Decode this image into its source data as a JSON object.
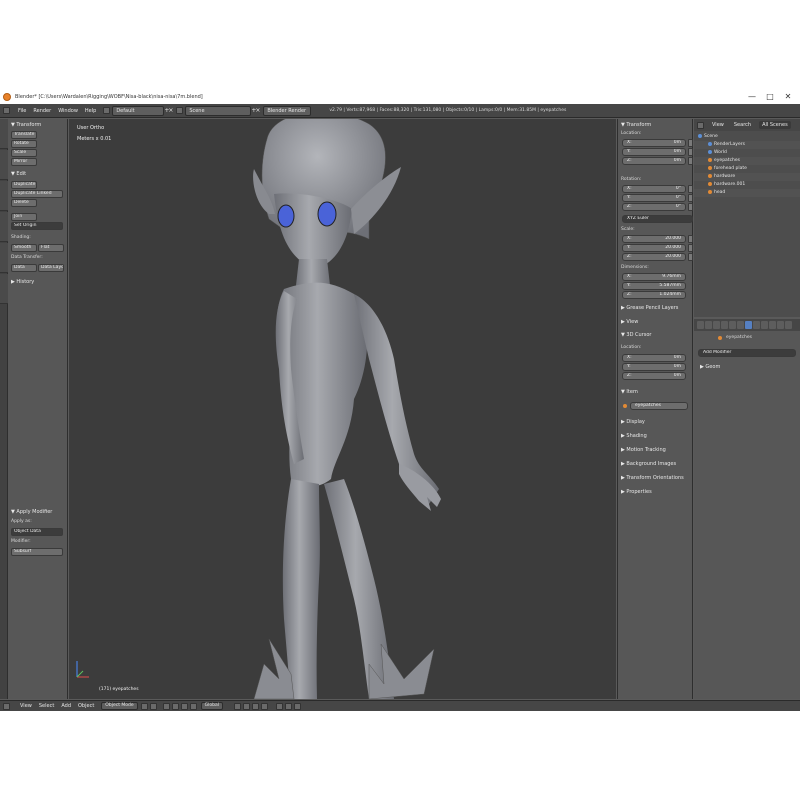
{
  "window": {
    "title": "Blender* [C:\\Users\\Wardalen\\Rigging\\WOBF\\Nisa-black\\nisa-nisa\\7m.blend]",
    "minimize": "—",
    "maximize": "□",
    "close": "✕"
  },
  "header": {
    "menus": [
      "File",
      "Render",
      "Window",
      "Help"
    ],
    "layout": "Default",
    "scene": "Scene",
    "engine": "Blender Render",
    "stats": "v2.79 | Verts:87,968 | Faces:88,320 | Tris:131,080 | Objects:0/10 | Lamps:0/0 | Mem:31.85M | eyepatches"
  },
  "toolshelf": {
    "transform_title": "▼ Transform",
    "transform_buttons": [
      "Translate",
      "Rotate",
      "Scale",
      "Mirror"
    ],
    "edit_title": "▼ Edit",
    "edit_buttons": [
      "Duplicate",
      "Duplicate Linked",
      "Delete"
    ],
    "join_label": "Join",
    "set_origin": "Set Origin",
    "shading_label": "Shading:",
    "smooth_label": "Smooth",
    "flat_label": "Flat",
    "data_transfer_label": "Data Transfer:",
    "data_label": "Data",
    "data_layout_label": "Data Layo",
    "history_title": "▶ History",
    "apply_modifier_title": "▼ Apply Modifier",
    "apply_as_label": "Apply as:",
    "apply_as_value": "Object Data",
    "modifier_label": "Modifier:",
    "modifier_value": "Subsurf"
  },
  "viewport": {
    "view_name": "User Ortho",
    "meters": "Meters x 0.01",
    "object_label": "(171) eyepatches"
  },
  "npanel": {
    "transform_title": "▼ Transform",
    "location_label": "Location:",
    "location": [
      {
        "k": "X:",
        "v": "0m"
      },
      {
        "k": "Y:",
        "v": "0m"
      },
      {
        "k": "Z:",
        "v": "0m"
      }
    ],
    "rotation_label": "Rotation:",
    "rotation": [
      {
        "k": "X:",
        "v": "0°"
      },
      {
        "k": "Y:",
        "v": "0°"
      },
      {
        "k": "Z:",
        "v": "0°"
      }
    ],
    "rotation_mode": "XYZ Euler",
    "scale_label": "Scale:",
    "scale": [
      {
        "k": "X:",
        "v": "20.000"
      },
      {
        "k": "Y:",
        "v": "20.000"
      },
      {
        "k": "Z:",
        "v": "20.000"
      }
    ],
    "dimensions_label": "Dimensions:",
    "dimensions": [
      {
        "k": "X:",
        "v": "9.76mm"
      },
      {
        "k": "Y:",
        "v": "5.587mm"
      },
      {
        "k": "Z:",
        "v": "1.024mm"
      }
    ],
    "grease_pencil": "▶ Grease Pencil Layers",
    "view": "▶ View",
    "cursor_title": "▼ 3D Cursor",
    "cursor_location_label": "Location:",
    "cursor": [
      {
        "k": "X:",
        "v": "0m"
      },
      {
        "k": "Y:",
        "v": "0m"
      },
      {
        "k": "Z:",
        "v": "0m"
      }
    ],
    "item_title": "▼ Item",
    "item_name": "eyepatches",
    "collapsed": [
      "▶ Display",
      "▶ Shading",
      "▶ Motion Tracking",
      "▶ Background Images",
      "▶ Transform Orientations",
      "▶ Properties"
    ]
  },
  "outliner": {
    "view": "View",
    "search": "Search",
    "filter": "All Scenes",
    "rows": [
      {
        "name": "Scene",
        "indent": 0,
        "icon": "scene"
      },
      {
        "name": "RenderLayers",
        "indent": 1,
        "icon": "layers"
      },
      {
        "name": "World",
        "indent": 1,
        "icon": "world"
      },
      {
        "name": "eyepatches",
        "indent": 1,
        "icon": "mesh"
      },
      {
        "name": "forehead plate",
        "indent": 1,
        "icon": "mesh"
      },
      {
        "name": "hardware",
        "indent": 1,
        "icon": "mesh"
      },
      {
        "name": "hardware.001",
        "indent": 1,
        "icon": "mesh"
      },
      {
        "name": "head",
        "indent": 1,
        "icon": "mesh"
      }
    ]
  },
  "properties": {
    "object_name": "eyepatches",
    "add_modifier": "Add Modifier",
    "geom": "▶ Geom"
  },
  "footer": {
    "menus": [
      "View",
      "Select",
      "Add",
      "Object"
    ],
    "mode": "Object Mode",
    "orientation": "Global"
  },
  "colors": {
    "accent": "#5680c2",
    "eye_blue": "#4a63d8",
    "figure_gray": "#8e9096"
  }
}
